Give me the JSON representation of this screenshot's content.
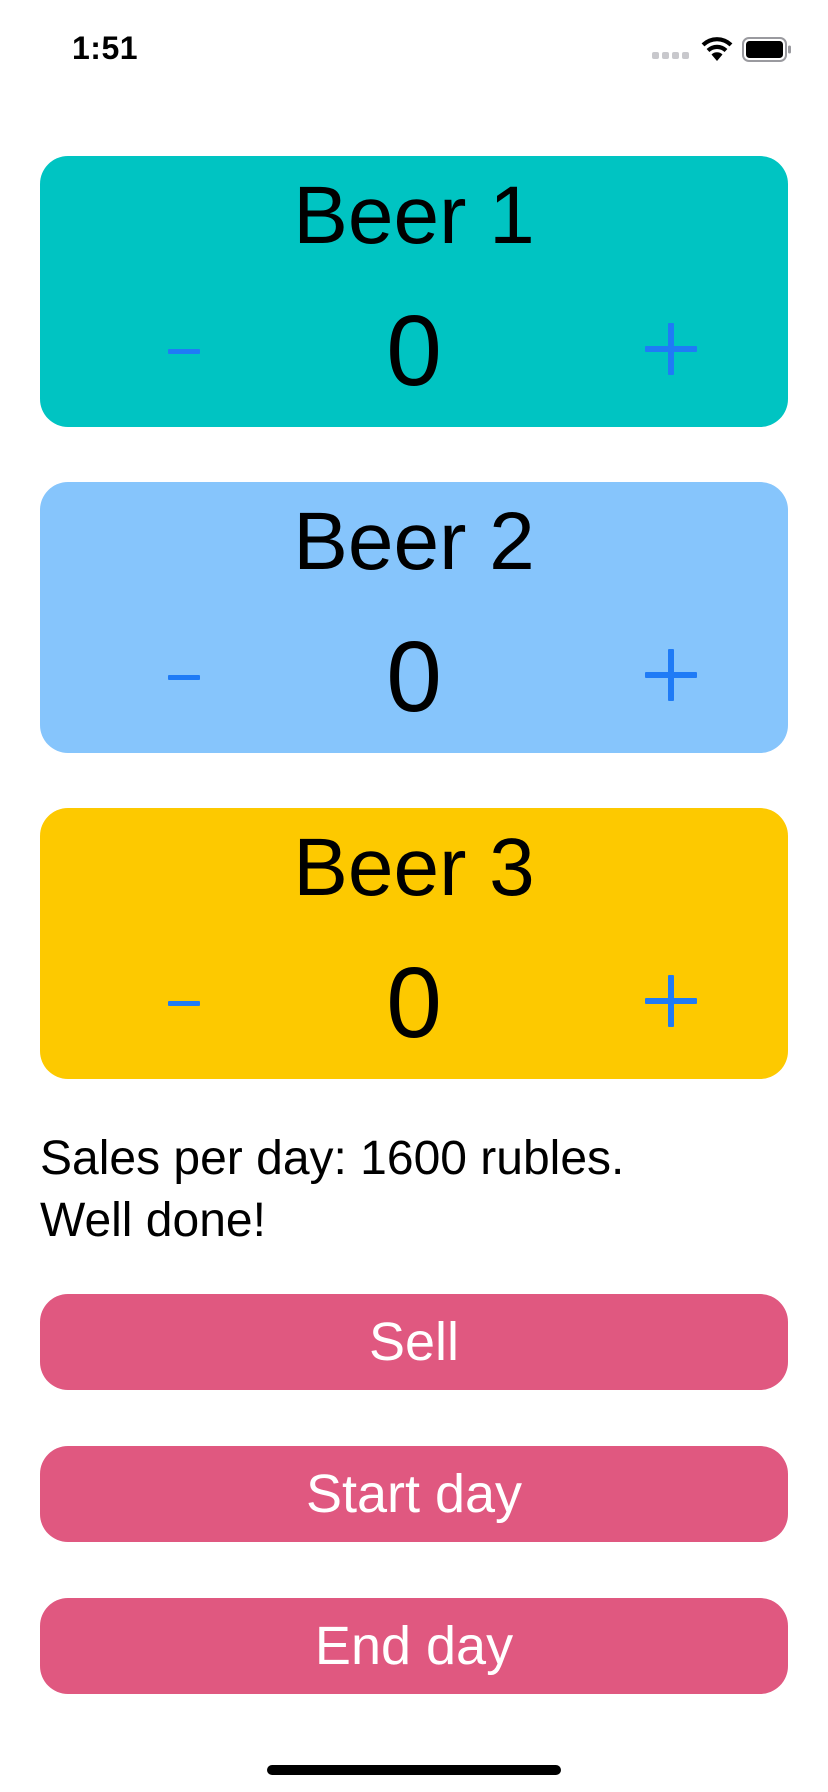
{
  "status_bar": {
    "time": "1:51",
    "icons": [
      "signal-icon",
      "wifi-icon",
      "battery-icon"
    ]
  },
  "beers": [
    {
      "name": "Beer 1",
      "count": "0",
      "minus_label": "-",
      "plus_label": "+",
      "color": "#00c4c2"
    },
    {
      "name": "Beer 2",
      "count": "0",
      "minus_label": "-",
      "plus_label": "+",
      "color": "#86c5fc"
    },
    {
      "name": "Beer 3",
      "count": "0",
      "minus_label": "-",
      "plus_label": "+",
      "color": "#fdc900"
    }
  ],
  "sales": {
    "line1": "Sales per day: 1600 rubles.",
    "line2": "Well done!"
  },
  "buttons": {
    "sell": "Sell",
    "start_day": "Start day",
    "end_day": "End day",
    "color": "#e05880"
  },
  "colors": {
    "accent_blue": "#1f7bf6"
  }
}
